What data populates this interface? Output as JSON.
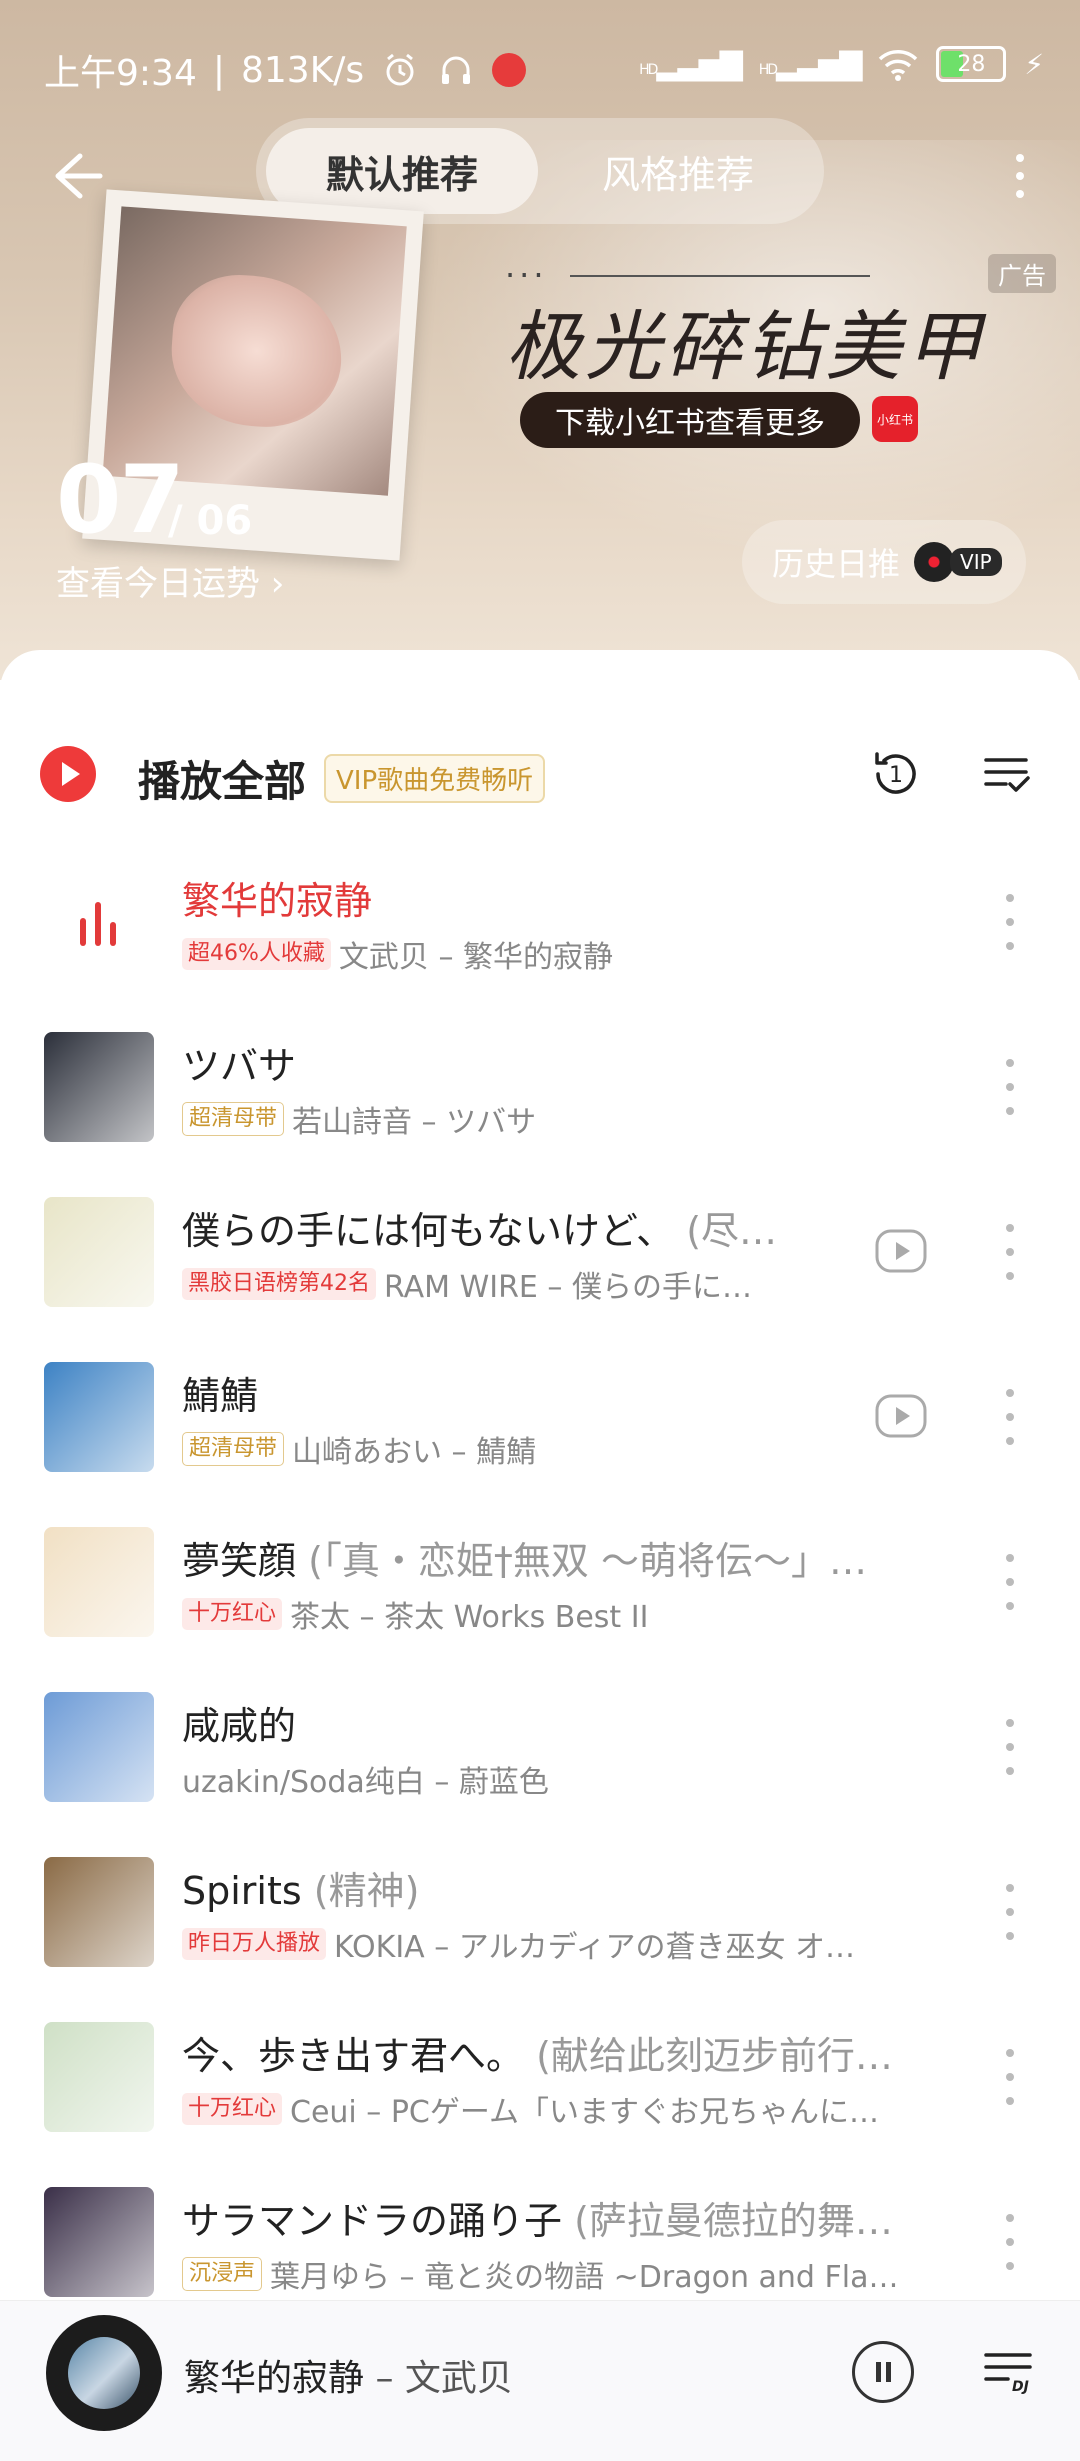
{
  "status_bar": {
    "time": "上午9:34",
    "speed": "813K/s",
    "signal_1": "HD",
    "signal_2": "HD",
    "battery": "28"
  },
  "tabs": [
    {
      "label": "默认推荐",
      "active": true
    },
    {
      "label": "风格推荐",
      "active": false
    }
  ],
  "ad": {
    "dots": "···",
    "title": "极光碎钻美甲",
    "button": "下载小红书查看更多",
    "logo": "小红书",
    "badge": "广告"
  },
  "date": {
    "day": "07",
    "month": "/ 06",
    "fortune": "查看今日运势 ›"
  },
  "history": {
    "label": "历史日推",
    "vip": "VIP"
  },
  "toolbar": {
    "play_all": "播放全部",
    "vip_free": "VIP歌曲免费畅听",
    "loop_count": "1"
  },
  "songs": [
    {
      "title": "繁华的寂静",
      "subtitle": "",
      "tag": "超46%人收藏",
      "tag_style": "red",
      "meta": "文武贝 – 繁华的寂静",
      "playing": true,
      "mv": false
    },
    {
      "title": "ツバサ",
      "subtitle": "",
      "tag": "超清母带",
      "tag_style": "gold",
      "meta": "若山詩音 – ツバサ",
      "playing": false,
      "mv": false
    },
    {
      "title": "僕らの手には何もないけど、",
      "subtitle": "(尽…",
      "tag": "黑胶日语榜第42名",
      "tag_style": "red",
      "meta": "RAM WIRE – 僕らの手に…",
      "playing": false,
      "mv": true
    },
    {
      "title": "鯖鯖",
      "subtitle": "",
      "tag": "超清母带",
      "tag_style": "gold",
      "meta": "山崎あおい – 鯖鯖",
      "playing": false,
      "mv": true
    },
    {
      "title": "夢笑顔",
      "subtitle": "(「真・恋姫†無双 〜萌将伝〜」…",
      "tag": "十万红心",
      "tag_style": "red",
      "meta": "茶太 – 茶太 Works Best II",
      "playing": false,
      "mv": false
    },
    {
      "title": "咸咸的",
      "subtitle": "",
      "tag": "",
      "tag_style": "",
      "meta": "uzakin/Soda纯白 – 蔚蓝色",
      "playing": false,
      "mv": false
    },
    {
      "title": "Spirits",
      "subtitle": "(精神)",
      "tag": "昨日万人播放",
      "tag_style": "red",
      "meta": "KOKIA – アルカディアの蒼き巫女 オ…",
      "playing": false,
      "mv": false
    },
    {
      "title": "今、歩き出す君へ。",
      "subtitle": "(献给此刻迈步前行…",
      "tag": "十万红心",
      "tag_style": "red",
      "meta": "Ceui – PCゲーム「いますぐお兄ちゃんに…",
      "playing": false,
      "mv": false
    },
    {
      "title": "サラマンドラの踊り子",
      "subtitle": "(萨拉曼德拉的舞…",
      "tag": "沉浸声",
      "tag_style": "gold",
      "meta": "葉月ゆら – 竜と炎の物語 ~Dragon and Fla…",
      "playing": false,
      "mv": false
    }
  ],
  "cover_colors": [
    "#2b2f3a",
    "#e8e5c8",
    "#3d82c4",
    "#f1e0c4",
    "#6d9bd6",
    "#8a6a45",
    "#cfe0c6",
    "#3a2f48"
  ],
  "player": {
    "title": "繁华的寂静",
    "artist": " – 文武贝"
  },
  "colors": {
    "accent": "#e23a3a",
    "hero_bg": "#d8c6b2"
  }
}
